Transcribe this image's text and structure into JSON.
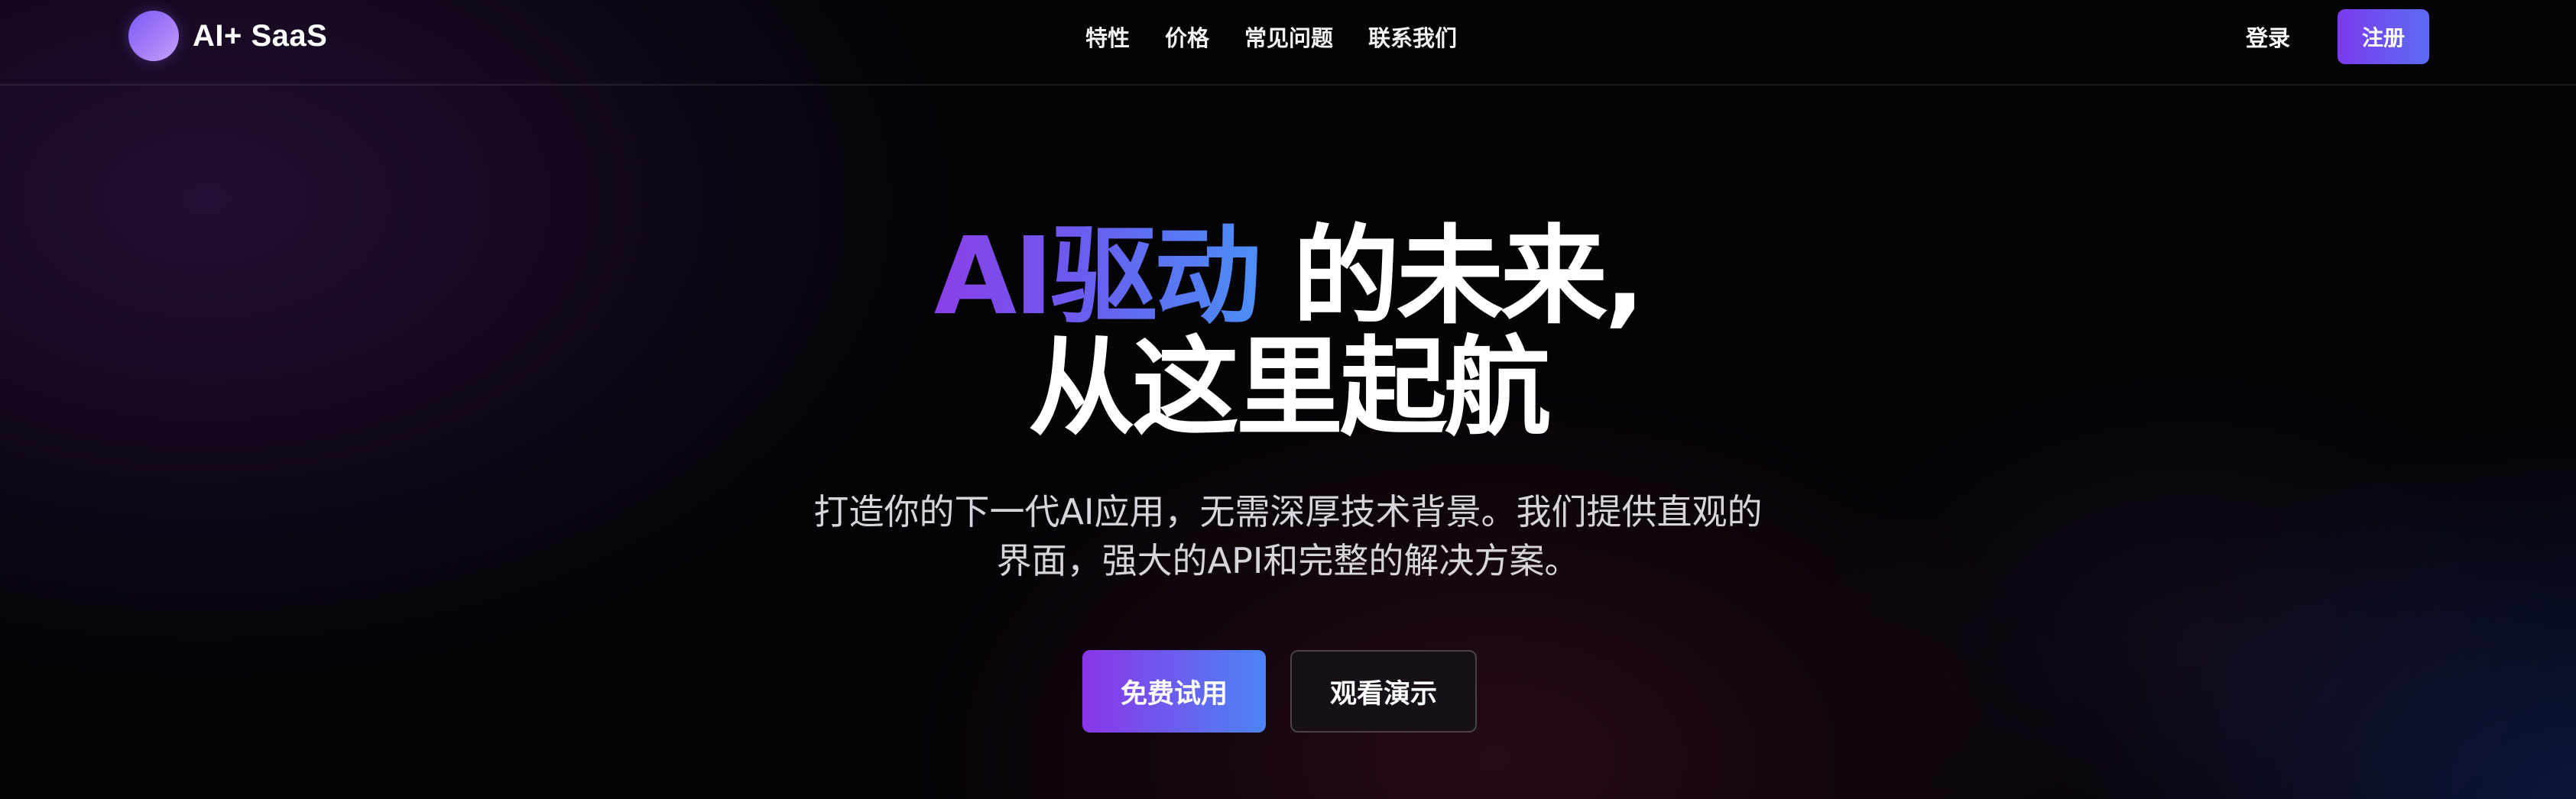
{
  "brand": {
    "name": "AI+ SaaS"
  },
  "nav": {
    "links": [
      "特性",
      "价格",
      "常见问题",
      "联系我们"
    ],
    "login_label": "登录",
    "signup_label": "注册"
  },
  "hero": {
    "title_gradient": "AI驱动",
    "title_line1_rest": "的未来,",
    "title_line2": "从这里起航",
    "subtitle_line1": "打造你的下一代AI应用，无需深厚技术背景。我们提供直观的",
    "subtitle_line2": "界面，强大的API和完整的解决方案。",
    "primary_cta": "免费试用",
    "secondary_cta": "观看演示"
  },
  "colors": {
    "accent_purple": "#8a36e6",
    "accent_blue": "#4d84f5",
    "background": "#040306"
  }
}
